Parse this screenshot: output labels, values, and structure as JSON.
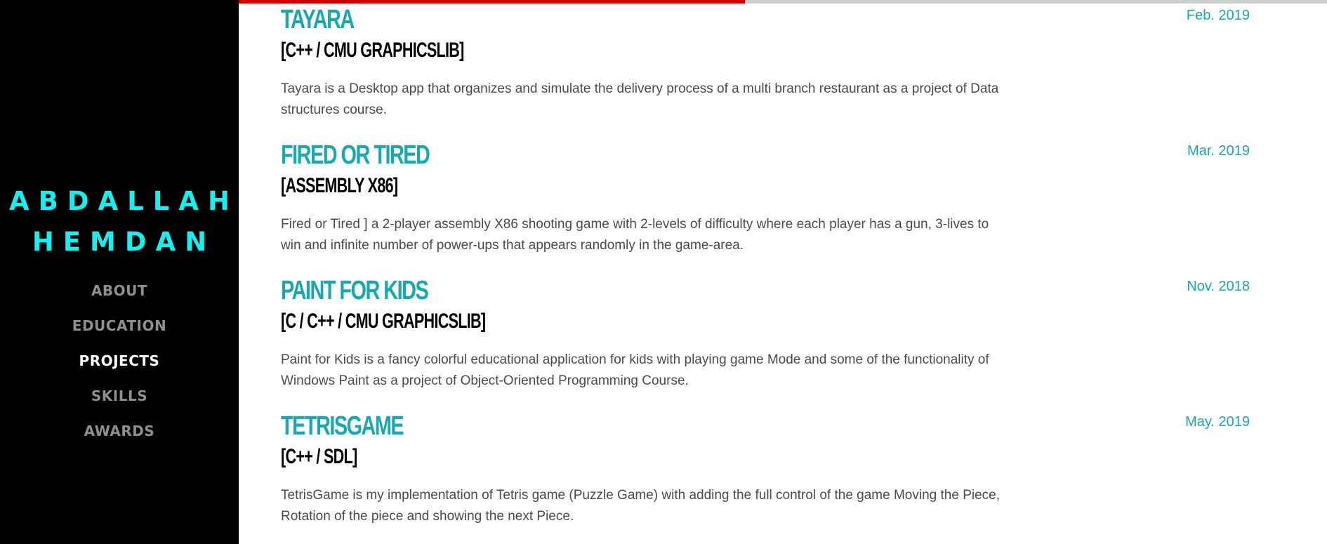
{
  "sidebar": {
    "name_line1": "ABDALLAH",
    "name_line2": "HEMDAN",
    "nav": [
      "ABOUT",
      "EDUCATION",
      "PROJECTS",
      "SKILLS",
      "AWARDS"
    ],
    "active": "PROJECTS"
  },
  "scroll_progress": 0.465,
  "colors": {
    "sidebar_bg": "#000000",
    "brand": "#14f0f0",
    "accent": "#17a8b0",
    "progress": "#d10000",
    "progress_track": "#cfcfcf"
  },
  "projects": [
    {
      "title": "TAYARA",
      "tech": "[C++ / CMU GRAPHICSLIB]",
      "date": "Feb. 2019",
      "description": "Tayara is a Desktop app that organizes and simulate the delivery process of a multi branch restaurant as a project of Data structures course."
    },
    {
      "title": "FIRED OR TIRED",
      "tech": "[ASSEMBLY X86]",
      "date": "Mar. 2019",
      "description": "Fired or Tired ] a 2-player assembly X86 shooting game with 2-levels of difficulty where each player has a gun, 3-lives to win and infinite number of power-ups that appears randomly in the game-area."
    },
    {
      "title": "PAINT FOR KIDS",
      "tech": "[C / C++ / CMU GRAPHICSLIB]",
      "date": "Nov. 2018",
      "description": "Paint for Kids is a fancy colorful educational application for kids with playing game Mode and some of the functionality of Windows Paint as a project of Object-Oriented Programming Course."
    },
    {
      "title": "TETRISGAME",
      "tech": "[C++ / SDL]",
      "date": "May. 2019",
      "description": "TetrisGame is my implementation of Tetris game (Puzzle Game) with adding the full control of the game Moving the Piece, Rotation of the piece and showing the next Piece."
    }
  ]
}
